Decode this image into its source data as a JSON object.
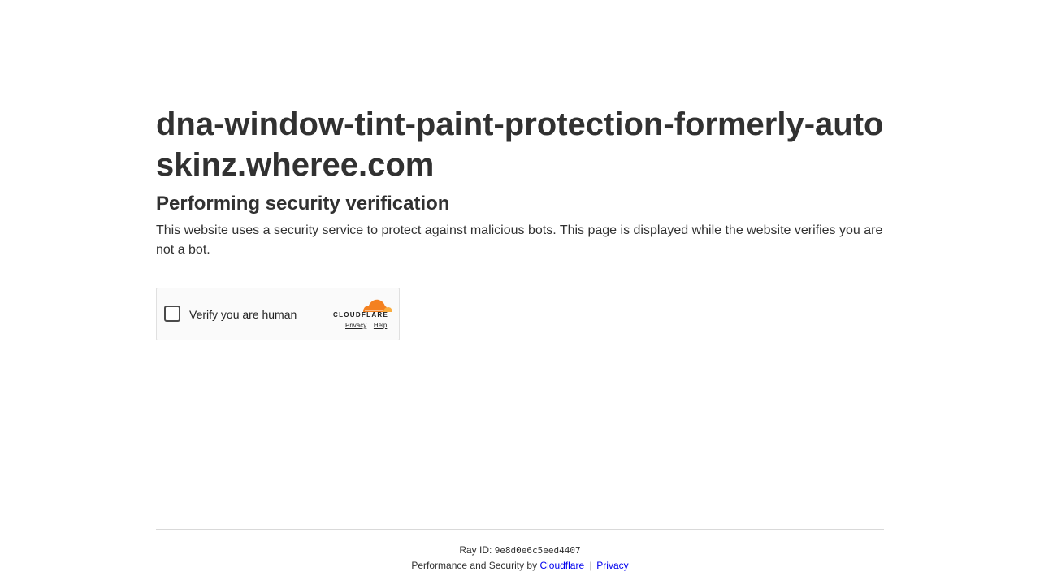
{
  "header": {
    "site_title": "dna-window-tint-paint-protection-formerly-autoskinz.wheree.com",
    "subtitle": "Performing security verification",
    "description": "This website uses a security service to protect against malicious bots. This page is displayed while the website verifies you are not a bot."
  },
  "widget": {
    "checkbox_label": "Verify you are human",
    "brand": "CLOUDFLARE",
    "privacy_link": "Privacy",
    "link_separator": "·",
    "help_link": "Help",
    "brand_colors": {
      "cloud_orange": "#f48120",
      "cloud_light_orange": "#faad3f"
    }
  },
  "footer": {
    "ray_label": "Ray ID:",
    "ray_id": "9e8d0e6c5eed4407",
    "performance_text": "Performance and Security by",
    "cloudflare_link": "Cloudflare",
    "separator": "|",
    "privacy_link": "Privacy"
  }
}
